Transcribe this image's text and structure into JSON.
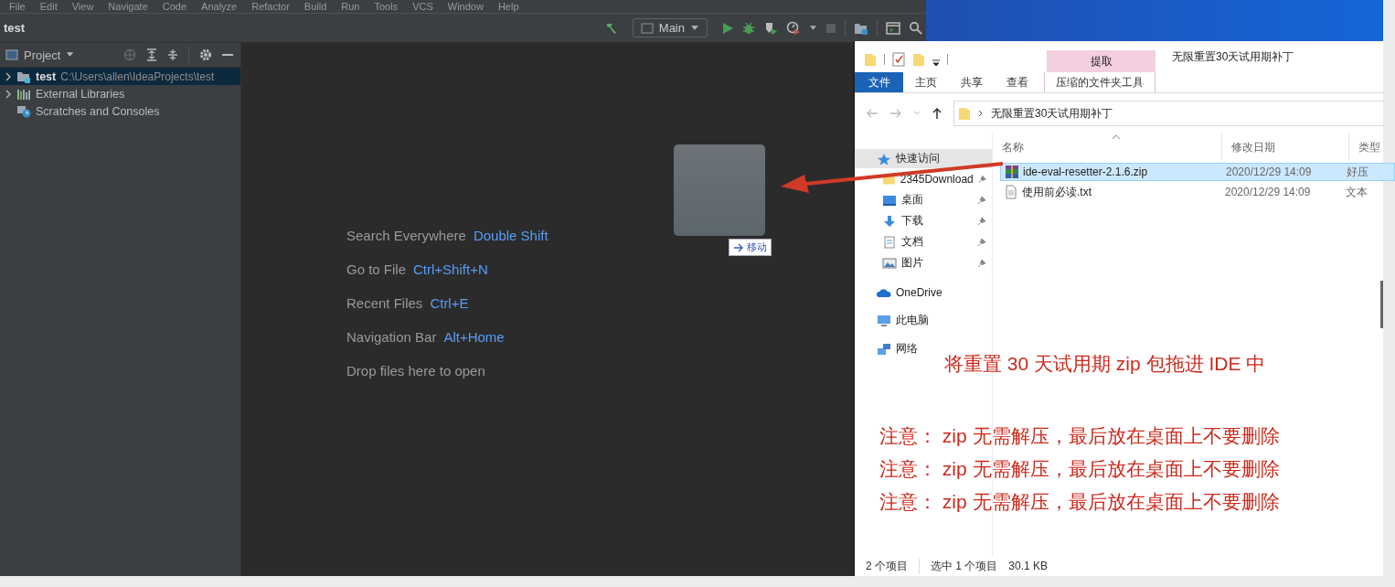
{
  "ide": {
    "menu": [
      "File",
      "Edit",
      "View",
      "Navigate",
      "Code",
      "Analyze",
      "Refactor",
      "Build",
      "Run",
      "Tools",
      "VCS",
      "Window",
      "Help"
    ],
    "project_name": "test",
    "run_config": "Main",
    "project_panel": {
      "title": "Project",
      "tree": [
        {
          "name": "test",
          "path": "C:\\Users\\allen\\IdeaProjects\\test",
          "kind": "module",
          "selected": true,
          "expandable": true
        },
        {
          "name": "External Libraries",
          "kind": "libraries",
          "selected": false,
          "expandable": true
        },
        {
          "name": "Scratches and Consoles",
          "kind": "scratches",
          "selected": false,
          "expandable": false
        }
      ]
    },
    "editor_hints": [
      {
        "label": "Search Everywhere",
        "shortcut": "Double Shift"
      },
      {
        "label": "Go to File",
        "shortcut": "Ctrl+Shift+N"
      },
      {
        "label": "Recent Files",
        "shortcut": "Ctrl+E"
      },
      {
        "label": "Navigation Bar",
        "shortcut": "Alt+Home"
      },
      {
        "label": "Drop files here to open"
      }
    ]
  },
  "drag": {
    "label": "移动"
  },
  "explorer": {
    "title": "无限重置30天试用期补丁",
    "context_header": "提取",
    "ribbon_tabs": [
      {
        "label": "文件",
        "kind": "file",
        "selected": true
      },
      {
        "label": "主页",
        "kind": "tab",
        "selected": false
      },
      {
        "label": "共享",
        "kind": "tab",
        "selected": false
      },
      {
        "label": "查看",
        "kind": "tab",
        "selected": false
      },
      {
        "label": "压缩的文件夹工具",
        "kind": "context",
        "selected": false
      }
    ],
    "address": "无限重置30天试用期补丁",
    "nav": [
      {
        "label": "快速访问",
        "kind": "star",
        "selected": true,
        "children": [
          {
            "label": "2345Download",
            "kind": "folder",
            "selected": false,
            "pinned": true
          },
          {
            "label": "桌面",
            "kind": "desktop",
            "selected": false,
            "pinned": true
          },
          {
            "label": "下载",
            "kind": "download",
            "selected": false,
            "pinned": true
          },
          {
            "label": "文档",
            "kind": "document",
            "selected": false,
            "pinned": true
          },
          {
            "label": "图片",
            "kind": "picture",
            "selected": false,
            "pinned": true
          }
        ]
      },
      {
        "label": "OneDrive",
        "kind": "cloud",
        "selected": false
      },
      {
        "label": "此电脑",
        "kind": "pc",
        "selected": false
      },
      {
        "label": "网络",
        "kind": "network",
        "selected": false
      }
    ],
    "columns": [
      "名称",
      "修改日期",
      "类型"
    ],
    "files": [
      {
        "name": "ide-eval-resetter-2.1.6.zip",
        "modified": "2020/12/29 14:09",
        "type": "好压",
        "kind": "zip",
        "selected": true
      },
      {
        "name": "使用前必读.txt",
        "modified": "2020/12/29 14:09",
        "type": "文本",
        "kind": "txt",
        "selected": false
      }
    ],
    "status": [
      "2 个项目",
      "选中 1 个项目",
      "30.1 KB"
    ]
  },
  "annotations": {
    "headline": "将重置 30 天试用期 zip 包拖进 IDE 中",
    "notes": [
      "注意： zip 无需解压，最后放在桌面上不要删除",
      "注意： zip 无需解压，最后放在桌面上不要删除",
      "注意： zip 无需解压，最后放在桌面上不要删除"
    ]
  }
}
